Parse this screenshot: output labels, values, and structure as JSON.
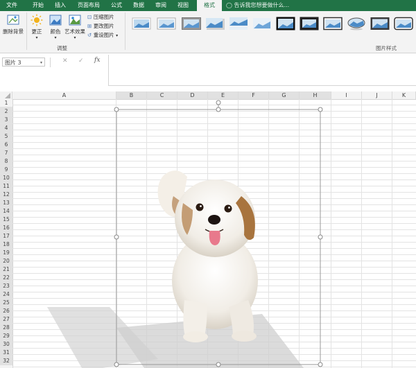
{
  "ribbon": {
    "tabs": [
      "文件",
      "开始",
      "插入",
      "页面布局",
      "公式",
      "数据",
      "审阅",
      "视图",
      "格式"
    ],
    "active_tab": "格式",
    "tell_me": "告诉我您想要做什么...",
    "adjust": {
      "remove_bg": "删除背景",
      "corrections": "更正",
      "color": "颜色",
      "artistic": "艺术效果",
      "compress": "压缩图片",
      "change": "更改图片",
      "reset": "重设图片",
      "group_label": "调整"
    },
    "picture_styles_label": "图片样式"
  },
  "formula_bar": {
    "name_box": "图片 3",
    "fx": "fx"
  },
  "columns": [
    "A",
    "B",
    "C",
    "D",
    "E",
    "F",
    "G",
    "H",
    "I",
    "J",
    "K"
  ],
  "rows": [
    "1",
    "2",
    "3",
    "4",
    "5",
    "6",
    "7",
    "8",
    "9",
    "10",
    "11",
    "12",
    "13",
    "14",
    "15",
    "16",
    "17",
    "18",
    "19",
    "20",
    "21",
    "22",
    "23",
    "24",
    "25",
    "26",
    "27",
    "28",
    "29",
    "30",
    "31",
    "32"
  ],
  "image": {
    "subject": "white-brown-dog-photo"
  }
}
